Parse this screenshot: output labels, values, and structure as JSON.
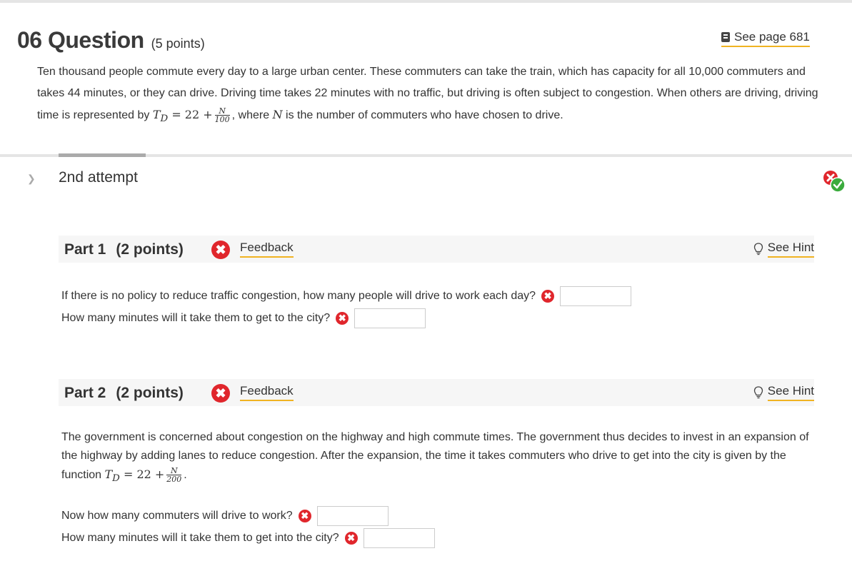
{
  "question": {
    "number": "06",
    "label": "Question",
    "points": "(5 points)",
    "see_page": "See page 681",
    "intro_main": "Ten thousand people commute every day to a large urban center. These commuters can take the train, which has capacity for all 10,000 commuters and takes 44 minutes, or they can drive. Driving time takes 22 minutes with no traffic, but driving is often subject to congestion. When others are driving, driving time is represented by",
    "intro_tail": ", where",
    "intro_end": "is the number of commuters who have chosen to drive.",
    "formula1": {
      "lhs": "T",
      "sub": "D",
      "rhs": "= 22 +",
      "num": "N",
      "den": "100"
    },
    "var_n": "N"
  },
  "attempt": {
    "label": "2nd attempt"
  },
  "part1": {
    "title": "Part 1",
    "points": "(2 points)",
    "feedback": "Feedback",
    "hint": "See Hint",
    "q1": "If there is no policy to reduce traffic congestion, how many people will drive to work each day?",
    "q2": "How many minutes will it take them to get to the city?"
  },
  "part2": {
    "title": "Part 2",
    "points": "(2 points)",
    "feedback": "Feedback",
    "hint": "See Hint",
    "text": "The government is concerned about congestion on the highway and high commute times. The government thus decides to invest in an expansion of the highway by adding lanes to reduce congestion. After the expansion, the time it takes commuters who drive to get into the city is given by the function",
    "formula2": {
      "lhs": "T",
      "sub": "D",
      "rhs": "= 22 +",
      "num": "N",
      "den": "200"
    },
    "q1": "Now how many commuters will drive to work?",
    "q2": "How many minutes will it take them to get into the city?"
  },
  "colors": {
    "incorrect": "#e0262c",
    "correct": "#3bab3d",
    "underline": "#f0b322"
  },
  "icons": [
    "book-icon",
    "chevron-down-icon",
    "incorrect-icon",
    "correct-icon",
    "lightbulb-icon"
  ]
}
